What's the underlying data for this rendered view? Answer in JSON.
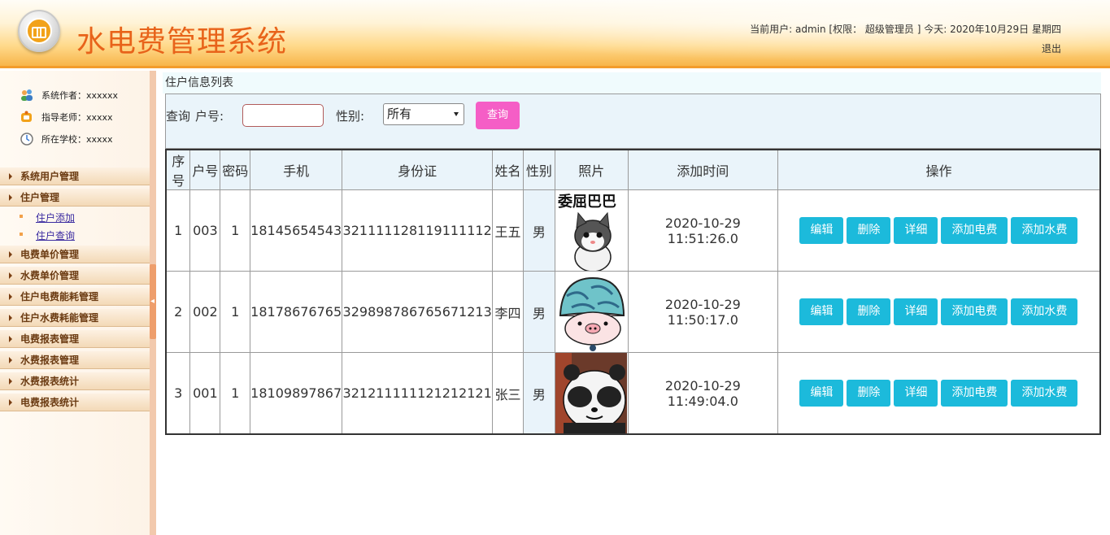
{
  "header": {
    "title": "水电费管理系统",
    "user_info": "当前用户: admin [权限： 超级管理员 ] 今天:   2020年10月29日 星期四",
    "logout_label": "退出"
  },
  "sidebar": {
    "info": [
      {
        "icon": "users-icon",
        "text": "系统作者：xxxxxx"
      },
      {
        "icon": "teacher-icon",
        "text": "指导老师：xxxxx"
      },
      {
        "icon": "school-icon",
        "text": "所在学校：xxxxx"
      }
    ],
    "menus": [
      {
        "label": "系统用户管理"
      },
      {
        "label": "住户管理",
        "children": [
          "住户添加",
          "住户查询"
        ]
      },
      {
        "label": "电费单价管理"
      },
      {
        "label": "水费单价管理"
      },
      {
        "label": "住户电费能耗管理"
      },
      {
        "label": "住户水费耗能管理"
      },
      {
        "label": "电费报表管理"
      },
      {
        "label": "水费报表管理"
      },
      {
        "label": "水费报表统计"
      },
      {
        "label": "电费报表统计"
      }
    ]
  },
  "main": {
    "panel_title": "住户信息列表",
    "search": {
      "query_label": "查询",
      "house_no_label": "户号:",
      "house_no_value": "",
      "gender_label": "性别:",
      "gender_selected": "所有",
      "query_button": "查询"
    },
    "table": {
      "headers": [
        "序号",
        "户号",
        "密码",
        "手机",
        "身份证",
        "姓名",
        "性别",
        "照片",
        "添加时间",
        "操作"
      ],
      "rows": [
        {
          "index": "1",
          "house_no": "003",
          "password": "1",
          "phone": "18145654543",
          "id_card": "321111128119111112",
          "name": "王五",
          "gender": "男",
          "photo": "cat-sticker-image",
          "photo_caption": "委屈巴巴",
          "added_time": "2020-10-29 11:51:26.0"
        },
        {
          "index": "2",
          "house_no": "002",
          "password": "1",
          "phone": "18178676765",
          "id_card": "329898786765671213",
          "name": "李四",
          "gender": "男",
          "photo": "pig-helmet-sticker-image",
          "added_time": "2020-10-29 11:50:17.0"
        },
        {
          "index": "3",
          "house_no": "001",
          "password": "1",
          "phone": "18109897867",
          "id_card": "321211111121212121",
          "name": "张三",
          "gender": "男",
          "photo": "panda-sticker-image",
          "added_time": "2020-10-29 11:49:04.0"
        }
      ],
      "actions": [
        "编辑",
        "删除",
        "详细",
        "添加电费",
        "添加水费"
      ]
    }
  },
  "colors": {
    "title": "#e8631a",
    "query_button": "#f55ec6",
    "action_button": "#1cbadb",
    "menu_text": "#6b3b12"
  }
}
